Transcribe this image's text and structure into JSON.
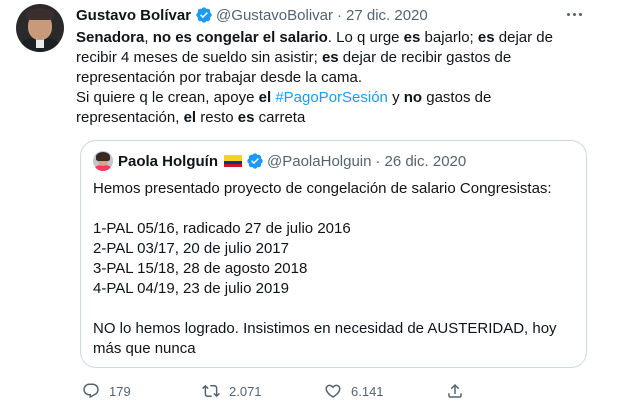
{
  "author": {
    "name": "Gustavo Bolívar",
    "handle": "@GustavoBolivar",
    "separator": "·",
    "date": "27 dic. 2020"
  },
  "tweet_lines": [
    [
      {
        "t": "Senadora",
        "b": true
      },
      {
        "t": ", ",
        "b": false
      },
      {
        "t": "no es congelar el salario",
        "b": true
      },
      {
        "t": ". Lo q urge ",
        "b": false
      },
      {
        "t": "es",
        "b": true
      },
      {
        "t": " bajarlo; ",
        "b": false
      },
      {
        "t": "es",
        "b": true
      },
      {
        "t": " dejar de",
        "b": false
      }
    ],
    [
      {
        "t": "recibir 4 meses de sueldo sin asistir; ",
        "b": false
      },
      {
        "t": "es",
        "b": true
      },
      {
        "t": " dejar de recibir gastos de",
        "b": false
      }
    ],
    [
      {
        "t": "representación por trabajar desde la cama.",
        "b": false
      }
    ],
    [
      {
        "t": "Si quiere q le crean, apoye ",
        "b": false
      },
      {
        "t": "el",
        "b": true
      },
      {
        "t": " ",
        "b": false
      },
      {
        "t": "#PagoPorSesión",
        "tag": true
      },
      {
        "t": " y ",
        "b": false
      },
      {
        "t": "no",
        "b": true
      },
      {
        "t": " gastos de",
        "b": false
      }
    ],
    [
      {
        "t": "representación, ",
        "b": false
      },
      {
        "t": "el",
        "b": true
      },
      {
        "t": " resto ",
        "b": false
      },
      {
        "t": "es",
        "b": true
      },
      {
        "t": " carreta",
        "b": false
      }
    ]
  ],
  "quoted": {
    "name": "Paola Holguín",
    "handle": "@PaolaHolguin",
    "separator": "·",
    "date": "26 dic. 2020",
    "lines": [
      "Hemos presentado proyecto de congelación de salario Congresistas:",
      "",
      "1-PAL 05/16, radicado 27 de julio 2016",
      "2-PAL 03/17, 20 de julio 2017",
      "3-PAL 15/18, 28 de agosto 2018",
      "4-PAL 04/19, 23 de julio 2019",
      "",
      "NO lo hemos logrado. Insistimos en necesidad de AUSTERIDAD, hoy",
      "más que nunca"
    ]
  },
  "actions": {
    "replies": "179",
    "retweets": "2.071",
    "likes": "6.141"
  },
  "icons": {
    "verified": "verified-badge-icon",
    "more": "more-options-icon",
    "reply": "reply-icon",
    "retweet": "retweet-icon",
    "like": "heart-icon",
    "share": "share-icon"
  },
  "colors": {
    "accent": "#1d9bf0",
    "muted": "#536471",
    "text": "#0f1419",
    "border": "#cfd9de"
  }
}
